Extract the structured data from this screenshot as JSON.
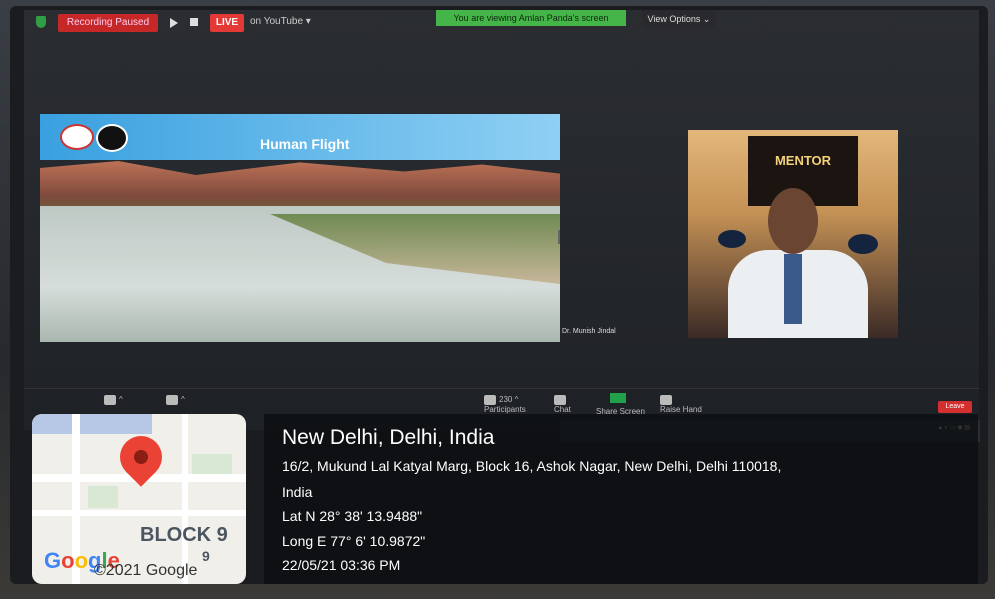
{
  "zoom_toolbar": {
    "recording_label": "Recording Paused",
    "live_label": "LIVE",
    "live_platform": "on YouTube ▾",
    "viewing_banner": "You are viewing Amlan Panda's screen",
    "view_options_label": "View Options ⌄"
  },
  "presentation": {
    "slide_title": "Human Flight"
  },
  "video_tile": {
    "participant_name": "Dr. Munish Jindal",
    "sign_text": "MENTOR"
  },
  "meeting_controls": {
    "participants_count": "230",
    "participants_label": "Participants",
    "chat_label": "Chat",
    "share_label": "Share Screen",
    "raise_hand_label": "Raise Hand",
    "leave_label": "Leave"
  },
  "map_thumb": {
    "block_label": "BLOCK 9",
    "block_number": "9",
    "google_copyright": "©2021 Google",
    "google_logo": "Google"
  },
  "location_overlay": {
    "place": "New Delhi, Delhi, India",
    "address_line1": "16/2, Mukund Lal Katyal Marg, Block 16, Ashok Nagar, New Delhi, Delhi 110018,",
    "address_line2": "India",
    "latitude": "Lat N 28° 38' 13.9488\"",
    "longitude": "Long E 77° 6' 10.9872\"",
    "timestamp": "22/05/21 03:36 PM"
  },
  "colors": {
    "live": "#e53935",
    "recording": "#c62828",
    "viewing_banner": "#46b549",
    "leave": "#d32f2f",
    "map_pin": "#ea4335"
  }
}
